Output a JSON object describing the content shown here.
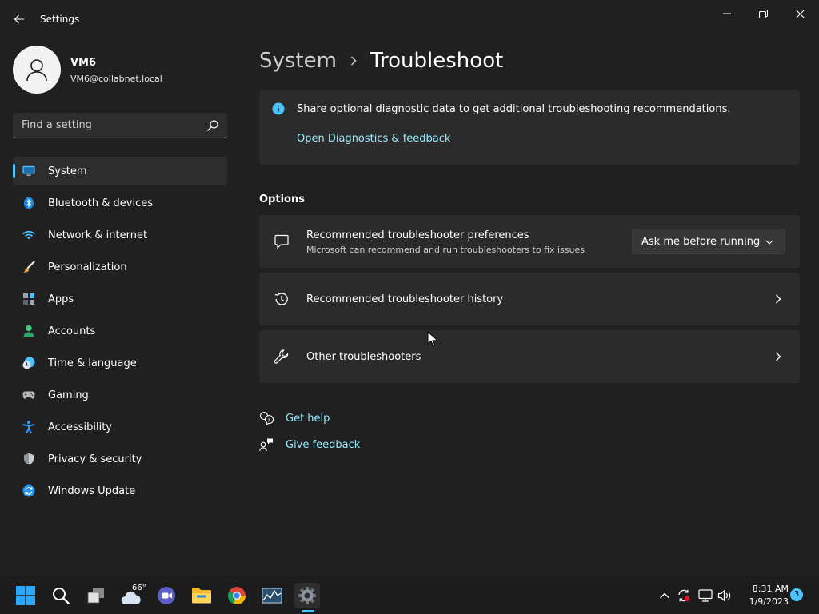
{
  "titlebar": {
    "title": "Settings"
  },
  "profile": {
    "name": "VM6",
    "email": "VM6@collabnet.local"
  },
  "search": {
    "placeholder": "Find a setting"
  },
  "sidebar": {
    "items": [
      {
        "label": "System",
        "icon": "monitor-icon",
        "selected": true
      },
      {
        "label": "Bluetooth & devices",
        "icon": "bluetooth-icon"
      },
      {
        "label": "Network & internet",
        "icon": "wifi-icon"
      },
      {
        "label": "Personalization",
        "icon": "brush-icon"
      },
      {
        "label": "Apps",
        "icon": "apps-icon"
      },
      {
        "label": "Accounts",
        "icon": "person-icon"
      },
      {
        "label": "Time & language",
        "icon": "clock-globe-icon"
      },
      {
        "label": "Gaming",
        "icon": "gamepad-icon"
      },
      {
        "label": "Accessibility",
        "icon": "accessibility-icon"
      },
      {
        "label": "Privacy & security",
        "icon": "shield-icon"
      },
      {
        "label": "Windows Update",
        "icon": "update-icon"
      }
    ]
  },
  "breadcrumb": {
    "parent": "System",
    "current": "Troubleshoot"
  },
  "info": {
    "text": "Share optional diagnostic data to get additional troubleshooting recommendations.",
    "link": "Open Diagnostics & feedback"
  },
  "options": {
    "title": "Options",
    "preferences": {
      "title": "Recommended troubleshooter preferences",
      "subtitle": "Microsoft can recommend and run troubleshooters to fix issues",
      "dropdown_value": "Ask me before running"
    },
    "history": {
      "title": "Recommended troubleshooter history"
    },
    "other": {
      "title": "Other troubleshooters"
    }
  },
  "help": {
    "get_help": "Get help",
    "give_feedback": "Give feedback"
  },
  "taskbar": {
    "weather_temp": "66°",
    "time": "8:31 AM",
    "date": "1/9/2023",
    "notification_count": "3"
  },
  "colors": {
    "accent": "#4cc2ff",
    "link": "#99ebff",
    "background": "#202020",
    "card": "#2b2b2b"
  }
}
